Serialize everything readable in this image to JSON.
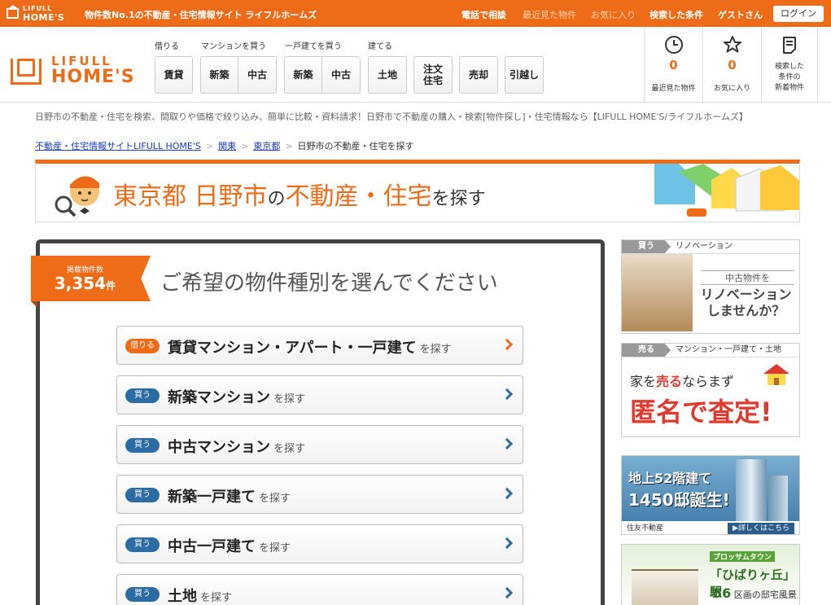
{
  "topbar": {
    "logo_line1": "LIFULL",
    "logo_line2": "HOME'S",
    "tagline": "物件数No.1の不動産・住宅情報サイト ライフルホームズ",
    "links": [
      "電話で相談",
      "最近見た物件",
      "お気に入り",
      "検索した条件",
      "ゲストさん"
    ],
    "login": "ログイン"
  },
  "header": {
    "logo_line1": "LIFULL",
    "logo_line2": "HOME'S",
    "categories": {
      "rent": "借りる",
      "mansion": "マンションを買う",
      "house": "一戸建てを買う",
      "build": "建てる"
    },
    "buttons": {
      "rent": "賃貸",
      "mansion_new": "新築",
      "mansion_used": "中古",
      "house_new": "新築",
      "house_used": "中古",
      "land": "土地",
      "custom_line1": "注文",
      "custom_line2": "住宅",
      "sell": "売却",
      "move": "引越し"
    },
    "stats": {
      "recent_count": "0",
      "recent_label": "最近見た物件",
      "fav_count": "0",
      "fav_label": "お気に入り",
      "saved_line1": "検索した",
      "saved_line2": "条件の",
      "saved_line3": "新着物件"
    }
  },
  "description": "日野市の不動産・住宅を検索、間取りや価格で絞り込み、簡単に比較・資料請求！日野市で不動産の購入・検索[物件探し]・住宅情報なら【LIFULL HOME'S/ライフルホームズ】",
  "breadcrumb": [
    "不動産・住宅情報サイトLIFULL HOME'S",
    "関東",
    "東京都",
    "日野市の不動産・住宅を探す"
  ],
  "hero": {
    "part1": "東京都 日野市",
    "part2": "の",
    "part3": "不動産・住宅",
    "part4": "を探す"
  },
  "main": {
    "count_label": "掲載物件数",
    "count": "3,354",
    "count_unit": "件",
    "heading": "ご希望の物件種別を選んでください",
    "types": [
      {
        "badge": "借りる",
        "name": "賃貸マンション・アパート・一戸建て",
        "suffix": "を探す"
      },
      {
        "badge": "買う",
        "name": "新築マンション",
        "suffix": "を探す"
      },
      {
        "badge": "買う",
        "name": "中古マンション",
        "suffix": "を探す"
      },
      {
        "badge": "買う",
        "name": "新築一戸建て",
        "suffix": "を探す"
      },
      {
        "badge": "買う",
        "name": "中古一戸建て",
        "suffix": "を探す"
      },
      {
        "badge": "買う",
        "name": "土地",
        "suffix": "を探す"
      }
    ]
  },
  "sidebar": {
    "ad1": {
      "tag": "買う",
      "title": "リノベーション",
      "line1": "中古物件を",
      "line2": "リノベーション",
      "line3": "しませんか？"
    },
    "ad2": {
      "tag": "売る",
      "title": "マンション・一戸建て・土地",
      "line1a": "家を",
      "line1b": "売る",
      "line1c": "ならまず",
      "line2": "匿名で査定!"
    },
    "ad3": {
      "line1": "地上52階建て",
      "line2": "1450邸誕生!",
      "brand": "住友不動産",
      "more": "▶詳しくはこちら"
    },
    "ad4": {
      "tag": "プロッサムタウン",
      "name": "「ひばりヶ丘」駅",
      "num": "56",
      "num_text": "区画の邸宅風景"
    }
  },
  "colors": {
    "brand_orange": "#ee6b17",
    "buy_blue": "#2a6ca3",
    "ad_red": "#e03a2e"
  }
}
